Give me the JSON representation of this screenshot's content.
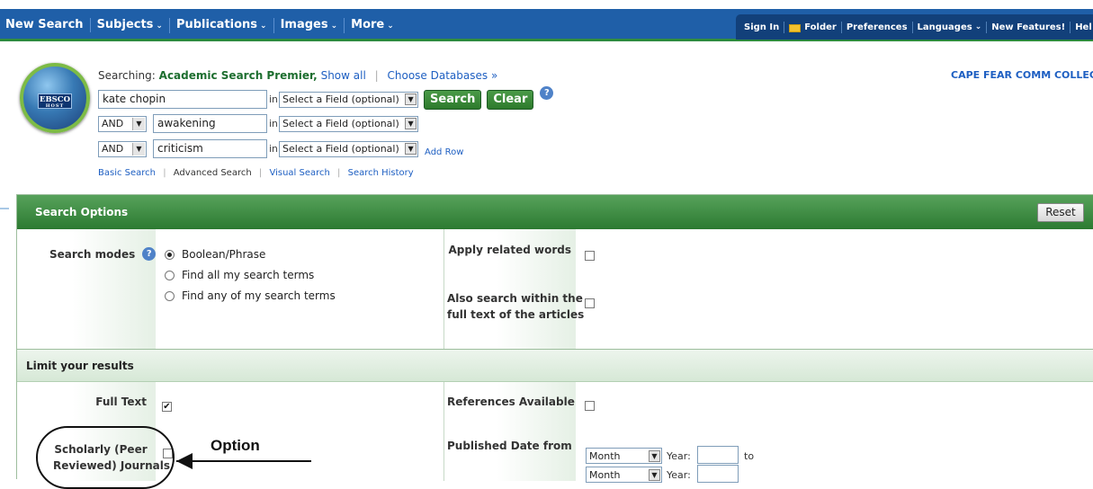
{
  "topnav": {
    "items": [
      "New Search",
      "Subjects",
      "Publications",
      "Images",
      "More"
    ]
  },
  "rightnav": {
    "sign_in": "Sign In",
    "folder": "Folder",
    "preferences": "Preferences",
    "languages": "Languages",
    "new_features": "New Features!",
    "help": "Hel"
  },
  "logo": {
    "line1": "EBSCO",
    "line2": "HOST"
  },
  "header": {
    "searching_label": "Searching:",
    "database": "Academic Search Premier,",
    "show_all": "Show all",
    "choose_databases": "Choose Databases »",
    "college": "CAPE FEAR COMM COLLEG"
  },
  "search": {
    "row1_term": "kate chopin",
    "row2_op": "AND",
    "row2_term": "awakening",
    "row3_op": "AND",
    "row3_term": "criticism",
    "in_label": "in",
    "field_placeholder": "Select a Field (optional)",
    "search_button": "Search",
    "clear_button": "Clear",
    "help_icon": "?",
    "add_row": "Add Row"
  },
  "subnav": {
    "basic": "Basic Search",
    "advanced": "Advanced Search",
    "visual": "Visual Search",
    "history": "Search History"
  },
  "options": {
    "title": "Search Options",
    "reset": "Reset",
    "search_modes_label": "Search modes",
    "modes": [
      "Boolean/Phrase",
      "Find all my search terms",
      "Find any of my search terms"
    ],
    "selected_mode": "Boolean/Phrase",
    "apply_related": "Apply related words",
    "also_search_line1": "Also search within the",
    "also_search_line2": "full text of the articles"
  },
  "limits": {
    "title": "Limit your results",
    "full_text": "Full Text",
    "full_text_checked": true,
    "references": "References Available",
    "scholarly_line1": "Scholarly (Peer",
    "scholarly_line2": "Reviewed) Journals",
    "published_date": "Published Date from",
    "month": "Month",
    "year_label": "Year:",
    "to_label": "to"
  },
  "annotation": {
    "label": "Option"
  }
}
